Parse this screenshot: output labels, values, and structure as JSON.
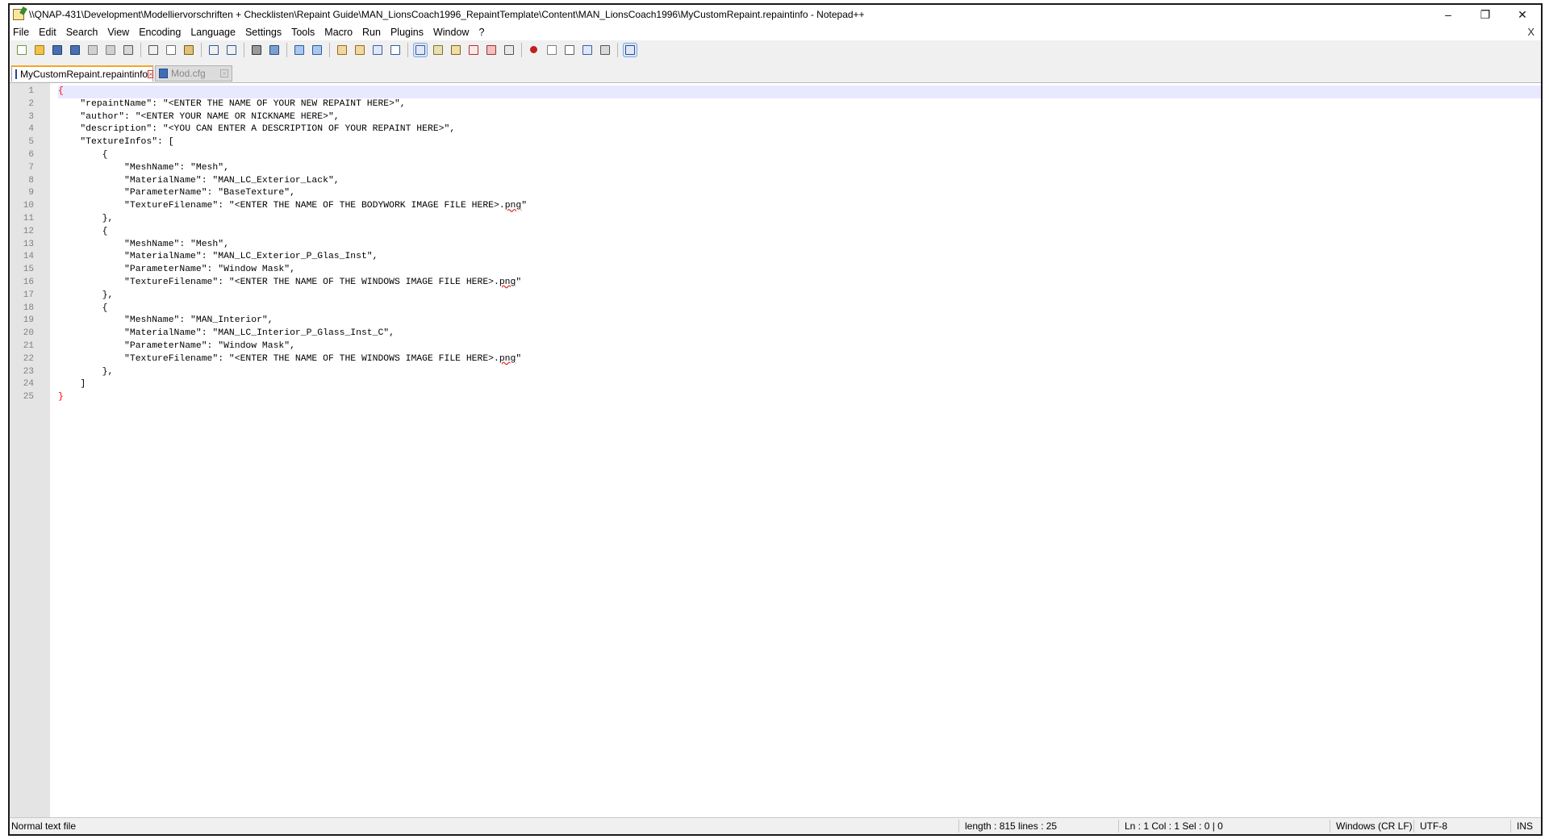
{
  "window": {
    "title": "\\\\QNAP-431\\Development\\Modelliervorschriften + Checklisten\\Repaint Guide\\MAN_LionsCoach1996_RepaintTemplate\\Content\\MAN_LionsCoach1996\\MyCustomRepaint.repaintinfo - Notepad++",
    "minimize": "–",
    "restore": "❐",
    "close": "✕"
  },
  "menu": {
    "items": [
      "File",
      "Edit",
      "Search",
      "View",
      "Encoding",
      "Language",
      "Settings",
      "Tools",
      "Macro",
      "Run",
      "Plugins",
      "Window",
      "?"
    ],
    "close_doc": "X"
  },
  "toolbar": {
    "buttons": [
      "new-file-icon",
      "open-file-icon",
      "save-icon",
      "save-all-icon",
      "close-icon",
      "close-all-icon",
      "print-icon",
      "|",
      "cut-icon",
      "copy-icon",
      "paste-icon",
      "|",
      "undo-icon",
      "redo-icon",
      "|",
      "find-icon",
      "replace-icon",
      "|",
      "zoom-in-icon",
      "zoom-out-icon",
      "|",
      "sync-vertical-icon",
      "sync-horizontal-icon",
      "word-wrap-icon",
      "show-all-chars-icon",
      "|",
      "indent-guide-icon",
      "udl-icon",
      "doc-map-icon",
      "function-list-icon",
      "folder-workspace-icon",
      "monitoring-icon",
      "|",
      "record-macro-icon",
      "stop-record-icon",
      "play-macro-icon",
      "run-macro-multiple-icon",
      "save-macro-icon",
      "|",
      "spell-check-icon"
    ],
    "active": [
      "indent-guide-icon",
      "spell-check-icon"
    ]
  },
  "tabs": [
    {
      "label": "MyCustomRepaint.repaintinfo",
      "active": true
    },
    {
      "label": "Mod.cfg",
      "active": false
    }
  ],
  "editor": {
    "lines": [
      "{",
      "    \"repaintName\": \"<ENTER THE NAME OF YOUR NEW REPAINT HERE>\",",
      "    \"author\": \"<ENTER YOUR NAME OR NICKNAME HERE>\",",
      "    \"description\": \"<YOU CAN ENTER A DESCRIPTION OF YOUR REPAINT HERE>\",",
      "    \"TextureInfos\": [",
      "        {",
      "            \"MeshName\": \"Mesh\",",
      "            \"MaterialName\": \"MAN_LC_Exterior_Lack\",",
      "            \"ParameterName\": \"BaseTexture\",",
      "            \"TextureFilename\": \"<ENTER THE NAME OF THE BODYWORK IMAGE FILE HERE>.png\"",
      "        },",
      "        {",
      "            \"MeshName\": \"Mesh\",",
      "            \"MaterialName\": \"MAN_LC_Exterior_P_Glas_Inst\",",
      "            \"ParameterName\": \"Window Mask\",",
      "            \"TextureFilename\": \"<ENTER THE NAME OF THE WINDOWS IMAGE FILE HERE>.png\"",
      "        },",
      "        {",
      "            \"MeshName\": \"MAN_Interior\",",
      "            \"MaterialName\": \"MAN_LC_Interior_P_Glass_Inst_C\",",
      "            \"ParameterName\": \"Window Mask\",",
      "            \"TextureFilename\": \"<ENTER THE NAME OF THE WINDOWS IMAGE FILE HERE>.png\"",
      "        },",
      "    ]",
      "}"
    ],
    "current_line": 1
  },
  "status": {
    "file_type": "Normal text file",
    "length_lines": "length : 815    lines : 25",
    "position": "Ln : 1    Col : 1    Sel : 0 | 0",
    "eol": "Windows (CR LF)",
    "encoding": "UTF-8",
    "mode": "INS"
  },
  "colors": {
    "active_tab_accent": "#f5a623",
    "current_line": "#e8e8ff",
    "brace_match": "#ff0000",
    "gutter": "#e4e4e4"
  }
}
